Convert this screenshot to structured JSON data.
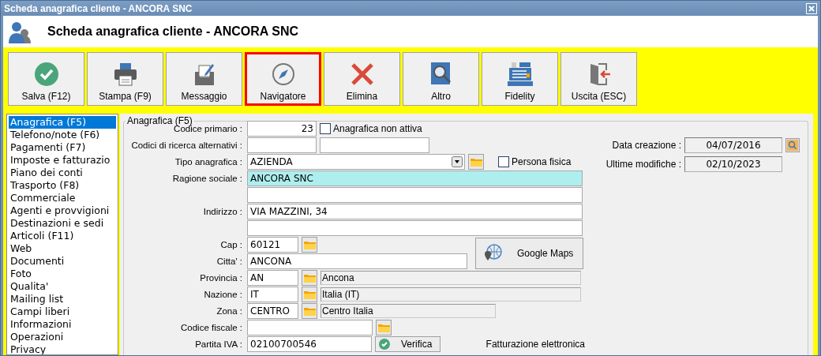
{
  "window": {
    "title": "Scheda anagrafica cliente - ANCORA SNC"
  },
  "header": {
    "title": "Scheda anagrafica cliente - ANCORA SNC"
  },
  "toolbar": [
    {
      "label": "Salva (F12)",
      "kind": "save",
      "selected": false
    },
    {
      "label": "Stampa (F9)",
      "kind": "print",
      "selected": false
    },
    {
      "label": "Messaggio",
      "kind": "message",
      "selected": false
    },
    {
      "label": "Navigatore",
      "kind": "compass",
      "selected": true
    },
    {
      "label": "Elimina",
      "kind": "delete",
      "selected": false
    },
    {
      "label": "Altro",
      "kind": "search",
      "selected": false
    },
    {
      "label": "Fidelity",
      "kind": "register",
      "selected": false
    },
    {
      "label": "Uscita (ESC)",
      "kind": "exit",
      "selected": false
    }
  ],
  "sidebar": [
    {
      "label": "Anagrafica (F5)",
      "selected": true
    },
    {
      "label": "Telefono/note (F6)",
      "selected": false
    },
    {
      "label": "Pagamenti (F7)",
      "selected": false
    },
    {
      "label": "Imposte e fatturazio",
      "selected": false
    },
    {
      "label": "Piano dei conti",
      "selected": false
    },
    {
      "label": "Trasporto (F8)",
      "selected": false
    },
    {
      "label": "Commerciale",
      "selected": false
    },
    {
      "label": "Agenti e provvigioni",
      "selected": false
    },
    {
      "label": "Destinazioni e sedi",
      "selected": false
    },
    {
      "label": "Articoli (F11)",
      "selected": false
    },
    {
      "label": "Web",
      "selected": false
    },
    {
      "label": "Documenti",
      "selected": false
    },
    {
      "label": "Foto",
      "selected": false
    },
    {
      "label": "Qualita'",
      "selected": false
    },
    {
      "label": "Mailing list",
      "selected": false
    },
    {
      "label": "Campi liberi",
      "selected": false
    },
    {
      "label": "Informazioni",
      "selected": false
    },
    {
      "label": "Operazioni",
      "selected": false
    },
    {
      "label": "Privacy",
      "selected": false
    }
  ],
  "group": {
    "title": "Anagrafica (F5)"
  },
  "form": {
    "codice_primario": {
      "label": "Codice primario :",
      "value": "23"
    },
    "non_attiva": {
      "label": "Anagrafica non attiva",
      "checked": false
    },
    "codici_ricerca": {
      "label": "Codici di ricerca alternativi :"
    },
    "tipo_anagrafica": {
      "label": "Tipo anagrafica :",
      "value": "AZIENDA"
    },
    "persona_fisica": {
      "label": "Persona fisica",
      "checked": false
    },
    "ragione_sociale": {
      "label": "Ragione sociale :",
      "value": "ANCORA SNC",
      "focused": true
    },
    "indirizzo": {
      "label": "Indirizzo :",
      "value": "VIA MAZZINI, 34"
    },
    "cap": {
      "label": "Cap :",
      "value": "60121"
    },
    "citta": {
      "label": "Citta' :",
      "value": "ANCONA"
    },
    "google_maps": {
      "label": "Google Maps"
    },
    "provincia": {
      "label": "Provincia :",
      "value": "AN",
      "description": "Ancona"
    },
    "nazione": {
      "label": "Nazione :",
      "value": "IT",
      "description": "Italia (IT)"
    },
    "zona": {
      "label": "Zona :",
      "value": "CENTRO",
      "description": "Centro Italia"
    },
    "codice_fiscale": {
      "label": "Codice fiscale :"
    },
    "partita_iva": {
      "label": "Partita IVA :",
      "value": "02100700546"
    },
    "verifica": {
      "label": "Verifica"
    },
    "fatturazione": {
      "title": "Fatturazione elettronica"
    }
  },
  "info": {
    "data_creazione": {
      "label": "Data creazione :",
      "value": "04/07/2016"
    },
    "ultime_modifiche": {
      "label": "Ultime modifiche :",
      "value": "02/10/2023"
    }
  }
}
